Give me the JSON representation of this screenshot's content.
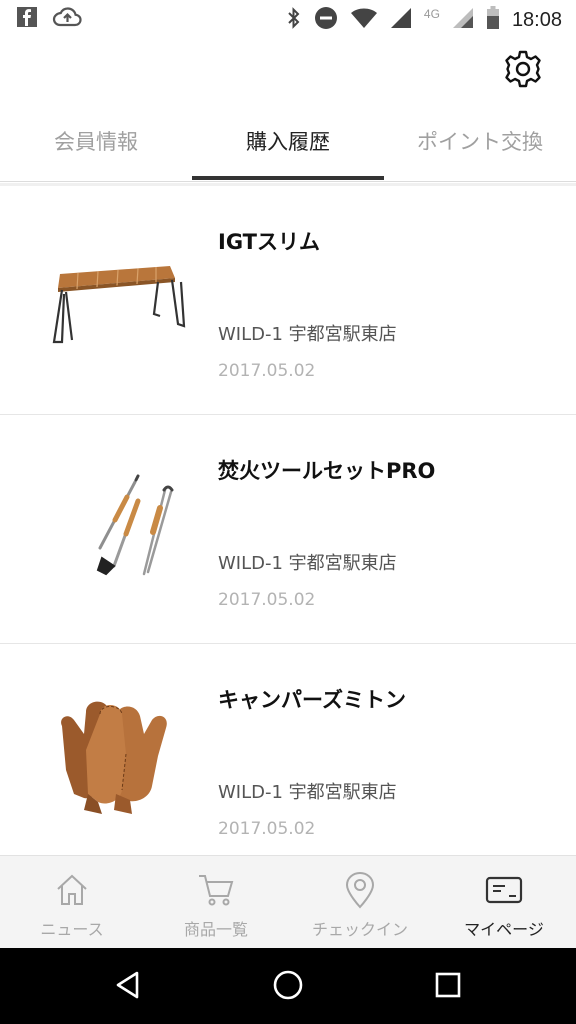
{
  "status_bar": {
    "time": "18:08",
    "network_label": "4G",
    "left_icons": [
      "facebook-icon",
      "cloud-upload-icon"
    ],
    "right_icons": [
      "bluetooth-icon",
      "do-not-disturb-icon",
      "wifi-icon",
      "signal-icon",
      "battery-icon"
    ]
  },
  "header": {
    "settings_icon": "gear-icon"
  },
  "tabs": [
    {
      "label": "会員情報",
      "active": false
    },
    {
      "label": "購入履歴",
      "active": true
    },
    {
      "label": "ポイント交換",
      "active": false
    }
  ],
  "purchases": [
    {
      "name": "IGTスリム",
      "store": "WILD-1 宇都宮駅東店",
      "date": "2017.05.02",
      "image": "igt-slim-table"
    },
    {
      "name": "焚火ツールセットPRO",
      "store": "WILD-1 宇都宮駅東店",
      "date": "2017.05.02",
      "image": "fire-tool-set"
    },
    {
      "name": "キャンパーズミトン",
      "store": "WILD-1 宇都宮駅東店",
      "date": "2017.05.02",
      "image": "leather-mittens"
    }
  ],
  "bottom_nav": [
    {
      "label": "ニュース",
      "icon": "home-icon",
      "active": false
    },
    {
      "label": "商品一覧",
      "icon": "cart-icon",
      "active": false
    },
    {
      "label": "チェックイン",
      "icon": "location-pin-icon",
      "active": false
    },
    {
      "label": "マイページ",
      "icon": "member-card-icon",
      "active": true
    }
  ],
  "system_nav": [
    "back-icon",
    "home-circle-icon",
    "recents-icon"
  ],
  "colors": {
    "active_text": "#222222",
    "inactive_text": "#a0a0a0",
    "date_text": "#b3b3b3",
    "nav_background": "#f4f4f4",
    "system_bar": "#000000"
  }
}
